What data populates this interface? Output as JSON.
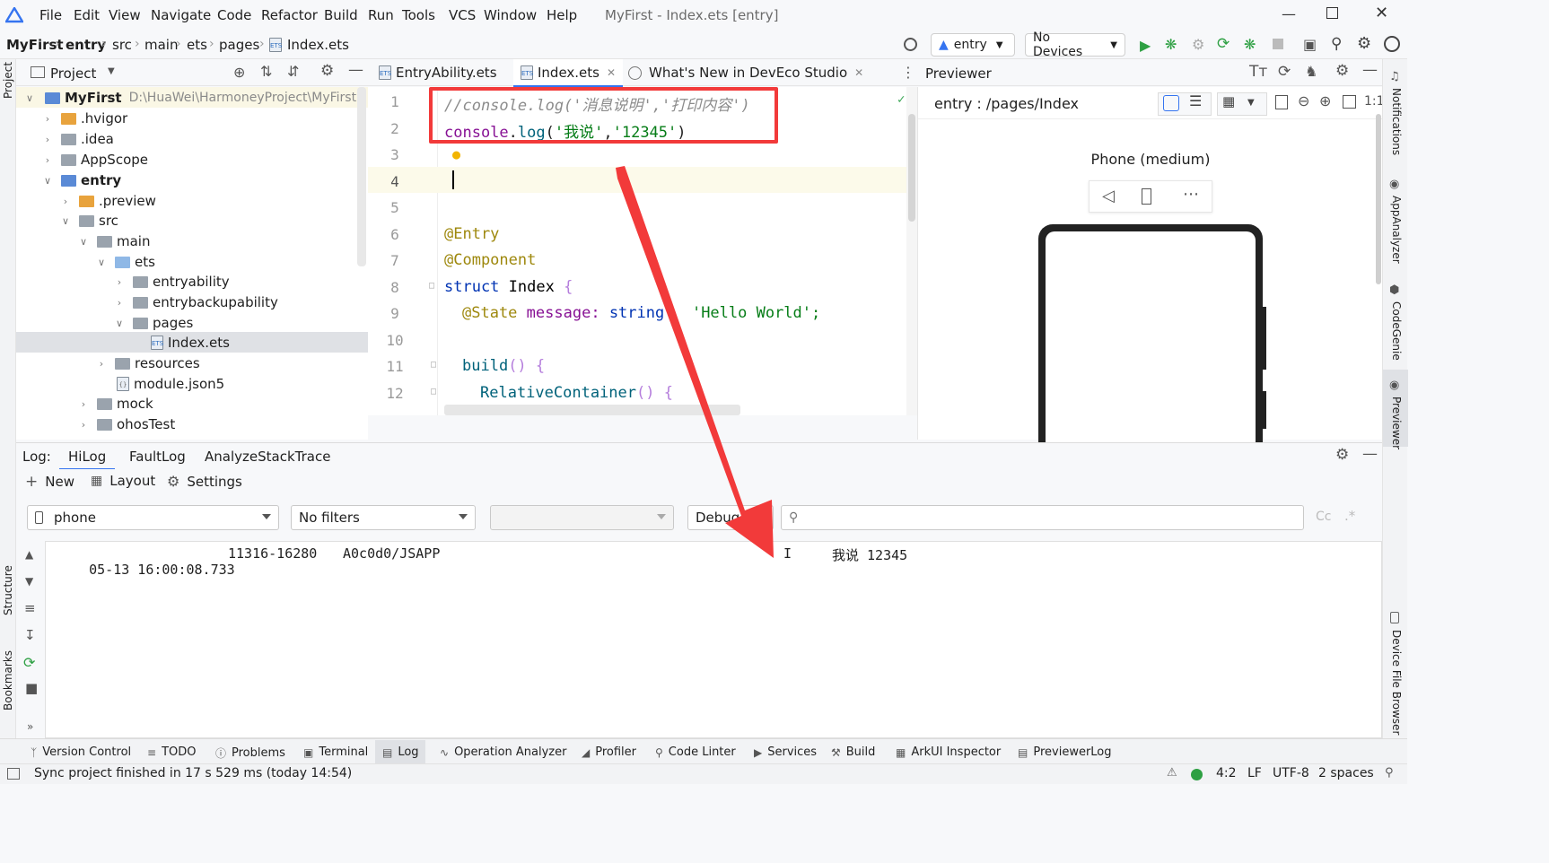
{
  "app": {
    "title": "MyFirst - Index.ets [entry]",
    "menu": [
      "File",
      "Edit",
      "View",
      "Navigate",
      "Code",
      "Refactor",
      "Build",
      "Run",
      "Tools",
      "VCS",
      "Window",
      "Help"
    ]
  },
  "breadcrumb": [
    "MyFirst",
    "entry",
    "src",
    "main",
    "ets",
    "pages",
    "Index.ets"
  ],
  "toolbar": {
    "config": "entry",
    "device": "No Devices"
  },
  "project": {
    "header": "Project",
    "root_name": "MyFirst",
    "root_path": "D:\\HuaWei\\HarmoneyProject\\MyFirst",
    "items": [
      ".hvigor",
      ".idea",
      "AppScope",
      "entry",
      ".preview",
      "src",
      "main",
      "ets",
      "entryability",
      "entrybackupability",
      "pages",
      "Index.ets",
      "resources",
      "module.json5",
      "mock",
      "ohosTest"
    ]
  },
  "editor": {
    "tabs": [
      "EntryAbility.ets",
      "Index.ets",
      "What's New in DevEco Studio"
    ],
    "line_numbers": [
      "1",
      "2",
      "3",
      "4",
      "5",
      "6",
      "7",
      "8",
      "9",
      "10",
      "11",
      "12"
    ],
    "lines": {
      "l1": "//console.log('消息说明','打印内容')",
      "l2_fn": "console",
      "l2_dot": ".",
      "l2_m": "log",
      "l2_p1": "(",
      "l2_s1": "'我说'",
      "l2_c": ",",
      "l2_s2": "'12345'",
      "l2_p2": ")",
      "l6": "@Entry",
      "l7": "@Component",
      "l8_kw": "struct",
      "l8_name": "Index",
      "l8_b": "{",
      "l9_dec": "@State",
      "l9_var": "message:",
      "l9_type": "string",
      "l9_val": "'Hello World';",
      "l11_fn": "build",
      "l11_rest": "() {",
      "l12_fn": "RelativeContainer",
      "l12_rest": "() {"
    }
  },
  "previewer": {
    "title": "Previewer",
    "path": "entry : /pages/Index",
    "device_label": "Phone (medium)"
  },
  "log": {
    "label": "Log:",
    "tabs": [
      "HiLog",
      "FaultLog",
      "AnalyzeStackTrace"
    ],
    "actions": {
      "new": "New",
      "layout": "Layout",
      "settings": "Settings"
    },
    "device_filter": "phone",
    "filter": "No filters",
    "process": "",
    "level": "Debug",
    "regex_label": "Cc",
    "entry": {
      "time": "05-13 16:00:08.733",
      "pid": "11316-16280",
      "tag": "A0c0d0/JSAPP",
      "level": "I",
      "message": "我说 12345"
    }
  },
  "left_strip": {
    "project": "Project",
    "structure": "Structure",
    "bookmarks": "Bookmarks"
  },
  "right_strip": [
    "Notifications",
    "AppAnalyzer",
    "CodeGenie",
    "Previewer",
    "Device File Browser"
  ],
  "tool_windows": [
    "Version Control",
    "TODO",
    "Problems",
    "Terminal",
    "Log",
    "Operation Analyzer",
    "Profiler",
    "Code Linter",
    "Services",
    "Build",
    "ArkUI Inspector",
    "PreviewerLog"
  ],
  "status": {
    "message": "Sync project finished in 17 s 529 ms (today 14:54)",
    "position": "4:2",
    "line_sep": "LF",
    "encoding": "UTF-8",
    "indent": "2 spaces"
  },
  "colors": {
    "accent": "#3574f0",
    "annotation_red": "#f23a3a",
    "string_green": "#067d17",
    "keyword_blue": "#0033b3",
    "comment_gray": "#8c8c8c",
    "annotation_olive": "#9e880d"
  }
}
